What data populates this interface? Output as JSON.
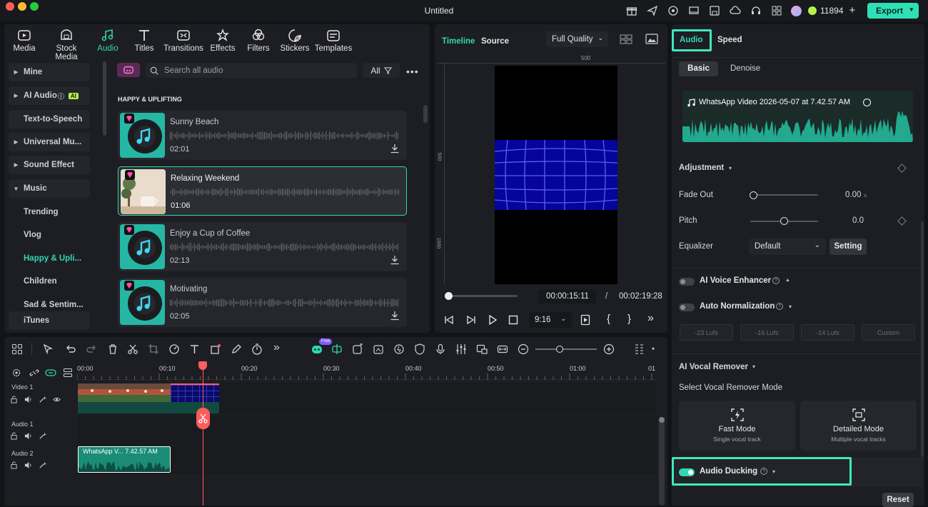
{
  "app": {
    "title": "Untitled",
    "credits": "11894",
    "export_label": "Export"
  },
  "toolbar_tabs": [
    {
      "label": "Media",
      "icon": "media-icon"
    },
    {
      "label": "Stock Media",
      "icon": "stock-media-icon"
    },
    {
      "label": "Audio",
      "icon": "music-note-icon",
      "active": true
    },
    {
      "label": "Titles",
      "icon": "titles-icon"
    },
    {
      "label": "Transitions",
      "icon": "transitions-icon"
    },
    {
      "label": "Effects",
      "icon": "effects-icon"
    },
    {
      "label": "Filters",
      "icon": "filters-icon"
    },
    {
      "label": "Stickers",
      "icon": "stickers-icon"
    },
    {
      "label": "Templates",
      "icon": "templates-icon"
    }
  ],
  "sidebar": {
    "items": [
      {
        "label": "Mine",
        "type": "cat"
      },
      {
        "label": "AI Audio",
        "type": "cat",
        "badge": "AI"
      },
      {
        "label": "Text-to-Speech",
        "type": "plain"
      },
      {
        "label": "Universal Mu...",
        "type": "cat"
      },
      {
        "label": "Sound Effect",
        "type": "cat"
      },
      {
        "label": "Music",
        "type": "cat-open"
      },
      {
        "label": "Trending",
        "type": "sub"
      },
      {
        "label": "Vlog",
        "type": "sub"
      },
      {
        "label": "Happy & Upli...",
        "type": "sub",
        "active": true
      },
      {
        "label": "Children",
        "type": "sub"
      },
      {
        "label": "Sad & Sentim...",
        "type": "sub"
      },
      {
        "label": "iTunes",
        "type": "plain"
      }
    ]
  },
  "library": {
    "search_placeholder": "Search all audio",
    "filter_label": "All",
    "section_title": "HAPPY & UPLIFTING",
    "tracks": [
      {
        "title": "Sunny Beach",
        "duration": "02:01"
      },
      {
        "title": "Relaxing Weekend",
        "duration": "01:06",
        "selected": true
      },
      {
        "title": "Enjoy a Cup of Coffee",
        "duration": "02:13"
      },
      {
        "title": "Motivating",
        "duration": "02:05"
      }
    ]
  },
  "player": {
    "tab_timeline": "Timeline",
    "tab_source": "Source",
    "quality": "Full Quality",
    "ruler": [
      "500"
    ],
    "ruler_v": [
      "500",
      "1000"
    ],
    "current_time": "00:00:15:11",
    "separator": "/",
    "total_time": "00:02:19:28",
    "aspect": "9:16",
    "progress": 0.03
  },
  "inspector": {
    "tab_audio": "Audio",
    "tab_speed": "Speed",
    "subtab_basic": "Basic",
    "subtab_denoise": "Denoise",
    "clip_name": "WhatsApp Video 2026-05-07 at 7.42.57 AM",
    "adjustment_label": "Adjustment",
    "fade_out_label": "Fade Out",
    "fade_out_value": "0.00",
    "fade_out_unit": "s",
    "pitch_label": "Pitch",
    "pitch_value": "0.0",
    "equalizer_label": "Equalizer",
    "equalizer_value": "Default",
    "setting_label": "Setting",
    "ai_voice_label": "AI Voice Enhancer",
    "auto_norm_label": "Auto Normalization",
    "lufs": [
      "-23 Lufs",
      "-16 Lufs",
      "-14 Lufs",
      "Custom"
    ],
    "vocal_remover_label": "AI Vocal Remover",
    "vocal_mode_label": "Select Vocal Remover Mode",
    "fast_mode_title": "Fast Mode",
    "fast_mode_sub": "Single vocal track",
    "detailed_mode_title": "Detailed Mode",
    "detailed_mode_sub": "Multiple vocal tracks",
    "ducking_label": "Audio Ducking",
    "reset_label": "Reset"
  },
  "timeline": {
    "ruler": [
      "00:00",
      "00:10",
      "00:20",
      "00:30",
      "00:40",
      "00:50",
      "01:00",
      "01"
    ],
    "tracks": [
      "Video 1",
      "Audio 1",
      "Audio 2"
    ],
    "audio_clip_label": "WhatsApp V... 7.42.57 AM",
    "free_badge": "Free"
  },
  "colors": {
    "accent": "#2fd8b3",
    "playhead": "#ff5c5c",
    "highlight": "#3ee8c0"
  }
}
